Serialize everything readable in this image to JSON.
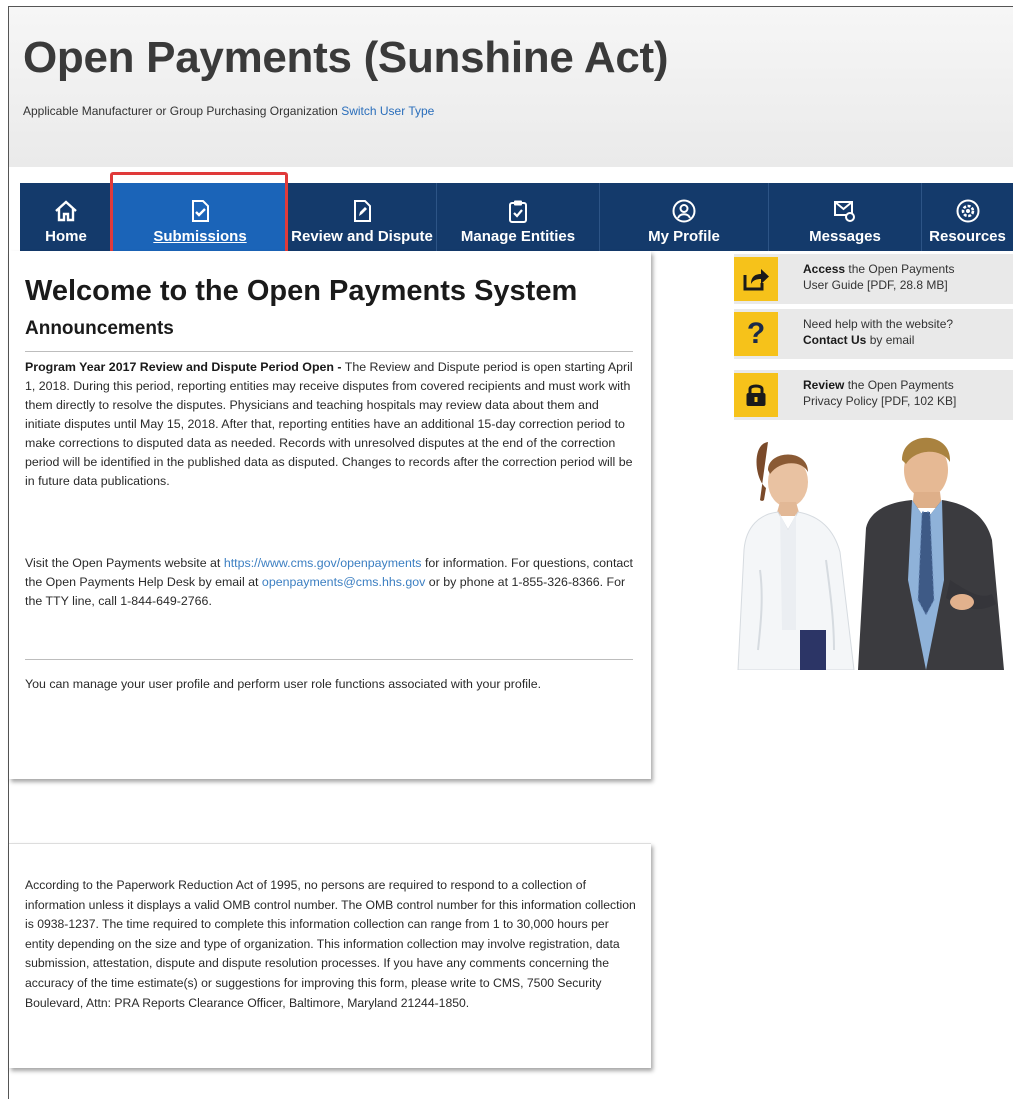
{
  "header": {
    "title": "Open Payments (Sunshine Act)",
    "user_type": "Applicable Manufacturer or Group Purchasing Organization",
    "switch_link": "Switch User Type"
  },
  "nav": {
    "home": "Home",
    "submissions": "Submissions",
    "review": "Review and Dispute",
    "entities": "Manage Entities",
    "profile": "My Profile",
    "messages": "Messages",
    "resources": "Resources",
    "active": "Submissions"
  },
  "main": {
    "welcome": "Welcome to the Open Payments System",
    "announcements": "Announcements",
    "announcement_title": "Program Year 2017 Review and Dispute Period Open -",
    "announcement_body": "The Review and Dispute period is open starting April 1, 2018. During this period, reporting entities may receive disputes from covered recipients and must work with them directly to resolve the disputes. Physicians and teaching hospitals may review data about them and initiate disputes until May 15, 2018. After that, reporting entities have an additional 15-day correction period to make corrections to disputed data as needed. Records with unresolved disputes at the end of the correction period will be identified in the published data as disputed. Changes to records after the correction period will be in future data publications.",
    "visit_pre": "Visit the Open Payments website at",
    "visit_link": "https://www.cms.gov/openpayments",
    "visit_mid": "for information. For questions, contact the Open Payments Help Desk by email at",
    "email_link": "openpayments@cms.hhs.gov",
    "visit_post": "or by phone at 1-855-326-8366. For the TTY line, call 1-844-649-2766.",
    "profile_note": "You can manage your user profile and perform user role functions associated with your profile."
  },
  "sidebar": {
    "guide_bold": "Access",
    "guide_text1": "the Open Payments",
    "guide_text2": "User Guide [PDF, 28.8 MB]",
    "help_text1": "Need help with the website?",
    "help_bold": "Contact Us",
    "help_text2": "by email",
    "privacy_bold": "Review",
    "privacy_text1": "the Open Payments",
    "privacy_text2": "Privacy Policy [PDF, 102 KB]",
    "icons": [
      "share-icon",
      "question-icon",
      "lock-icon"
    ],
    "icon_color": "#f6c21a"
  },
  "footer_notice": {
    "text": "According to the Paperwork Reduction Act of 1995, no persons are required to respond to a collection of information unless it displays a valid OMB control number. The OMB control number for this information collection is 0938-1237. The time required to complete this information collection can range from 1 to 30,000 hours per entity depending on the size and type of organization. This information collection may involve registration, data submission, attestation, dispute and dispute resolution processes. If you have any comments concerning the accuracy of the time estimate(s) or suggestions for improving this form, please write to CMS, 7500 Security Boulevard, Attn: PRA Reports Clearance Officer, Baltimore, Maryland 21244-1850."
  },
  "colors": {
    "nav_bg": "#143a6b",
    "nav_active": "#1b64b8",
    "highlight": "#e03a3a",
    "link": "#3c7fc2"
  }
}
